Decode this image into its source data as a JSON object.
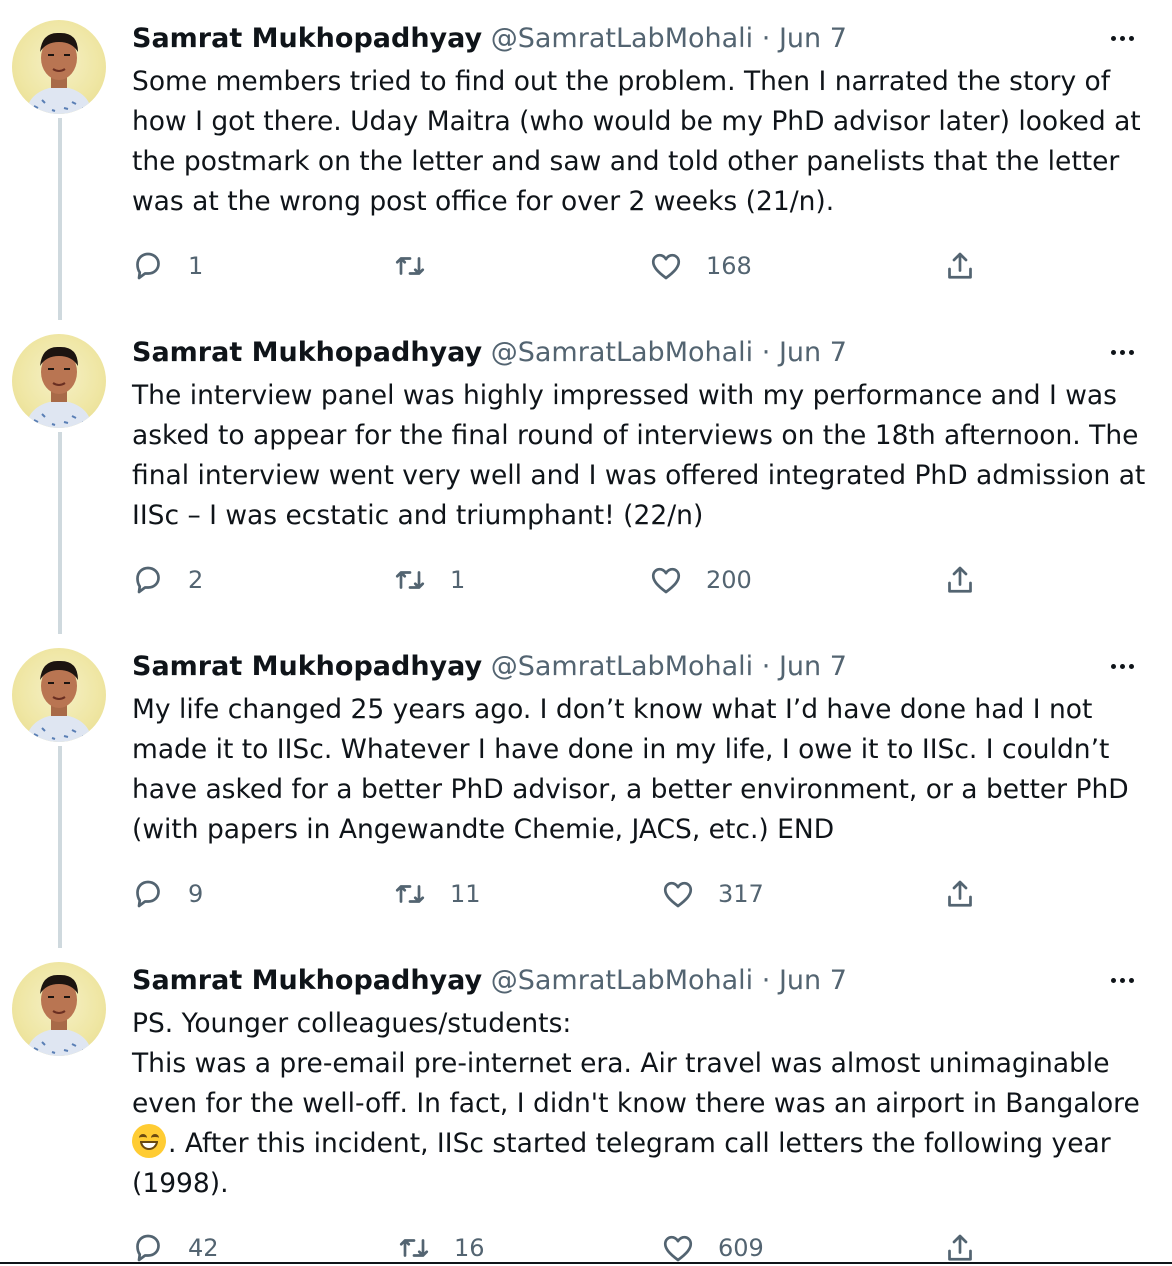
{
  "tweets": [
    {
      "name": "Samrat Mukhopadhyay",
      "handle": "@SamratLabMohali",
      "separator": "·",
      "date": "Jun 7",
      "lines": [
        "Some members tried to find out the problem. Then I narrated the story of",
        "how I got there. Uday Maitra (who would be my PhD advisor later) looked at",
        "the postmark on the letter and saw and told other panelists that the letter",
        "was at the wrong post office for over 2 weeks (21/n)."
      ],
      "replies": "1",
      "retweets": "",
      "likes": "168"
    },
    {
      "name": "Samrat Mukhopadhyay",
      "handle": "@SamratLabMohali",
      "separator": "·",
      "date": "Jun 7",
      "lines": [
        "The interview panel was highly impressed with my performance and I was",
        "asked to appear for the final round of interviews on the 18th afternoon. The",
        "final interview went very well and I was offered integrated PhD admission at",
        "IISc – I was ecstatic and triumphant! (22/n)"
      ],
      "replies": "2",
      "retweets": "1",
      "likes": "200"
    },
    {
      "name": "Samrat Mukhopadhyay",
      "handle": "@SamratLabMohali",
      "separator": "·",
      "date": "Jun 7",
      "lines": [
        "My life changed 25 years ago. I don’t know what I’d have done had I not",
        "made it to IISc. Whatever I have done in my life, I owe it to IISc. I couldn’t",
        "have asked for a better PhD advisor, a better environment, or a better PhD",
        "(with papers in Angewandte Chemie, JACS, etc.) END"
      ],
      "replies": "9",
      "retweets": "11",
      "likes": "317"
    },
    {
      "name": "Samrat Mukhopadhyay",
      "handle": "@SamratLabMohali",
      "separator": "·",
      "date": "Jun 7",
      "lines": [
        "PS. Younger colleagues/students:",
        "This was a pre-email pre-internet era. Air travel was almost unimaginable",
        "even for the well-off. In fact, I didn't know there was an airport in Bangalore"
      ],
      "emoji_line": ". After this incident, IISc started telegram call letters the following year",
      "last_line": "(1998).",
      "emoji_name": "grinning-face-emoji",
      "replies": "42",
      "retweets": "16",
      "likes": "609"
    }
  ],
  "icons": {
    "reply": "reply-icon",
    "retweet": "retweet-icon",
    "like": "heart-icon",
    "share": "share-icon",
    "more": "more-options-icon"
  },
  "colors": {
    "text": "#0f1419",
    "secondary": "#536471",
    "thread_line": "#cfd9de"
  }
}
